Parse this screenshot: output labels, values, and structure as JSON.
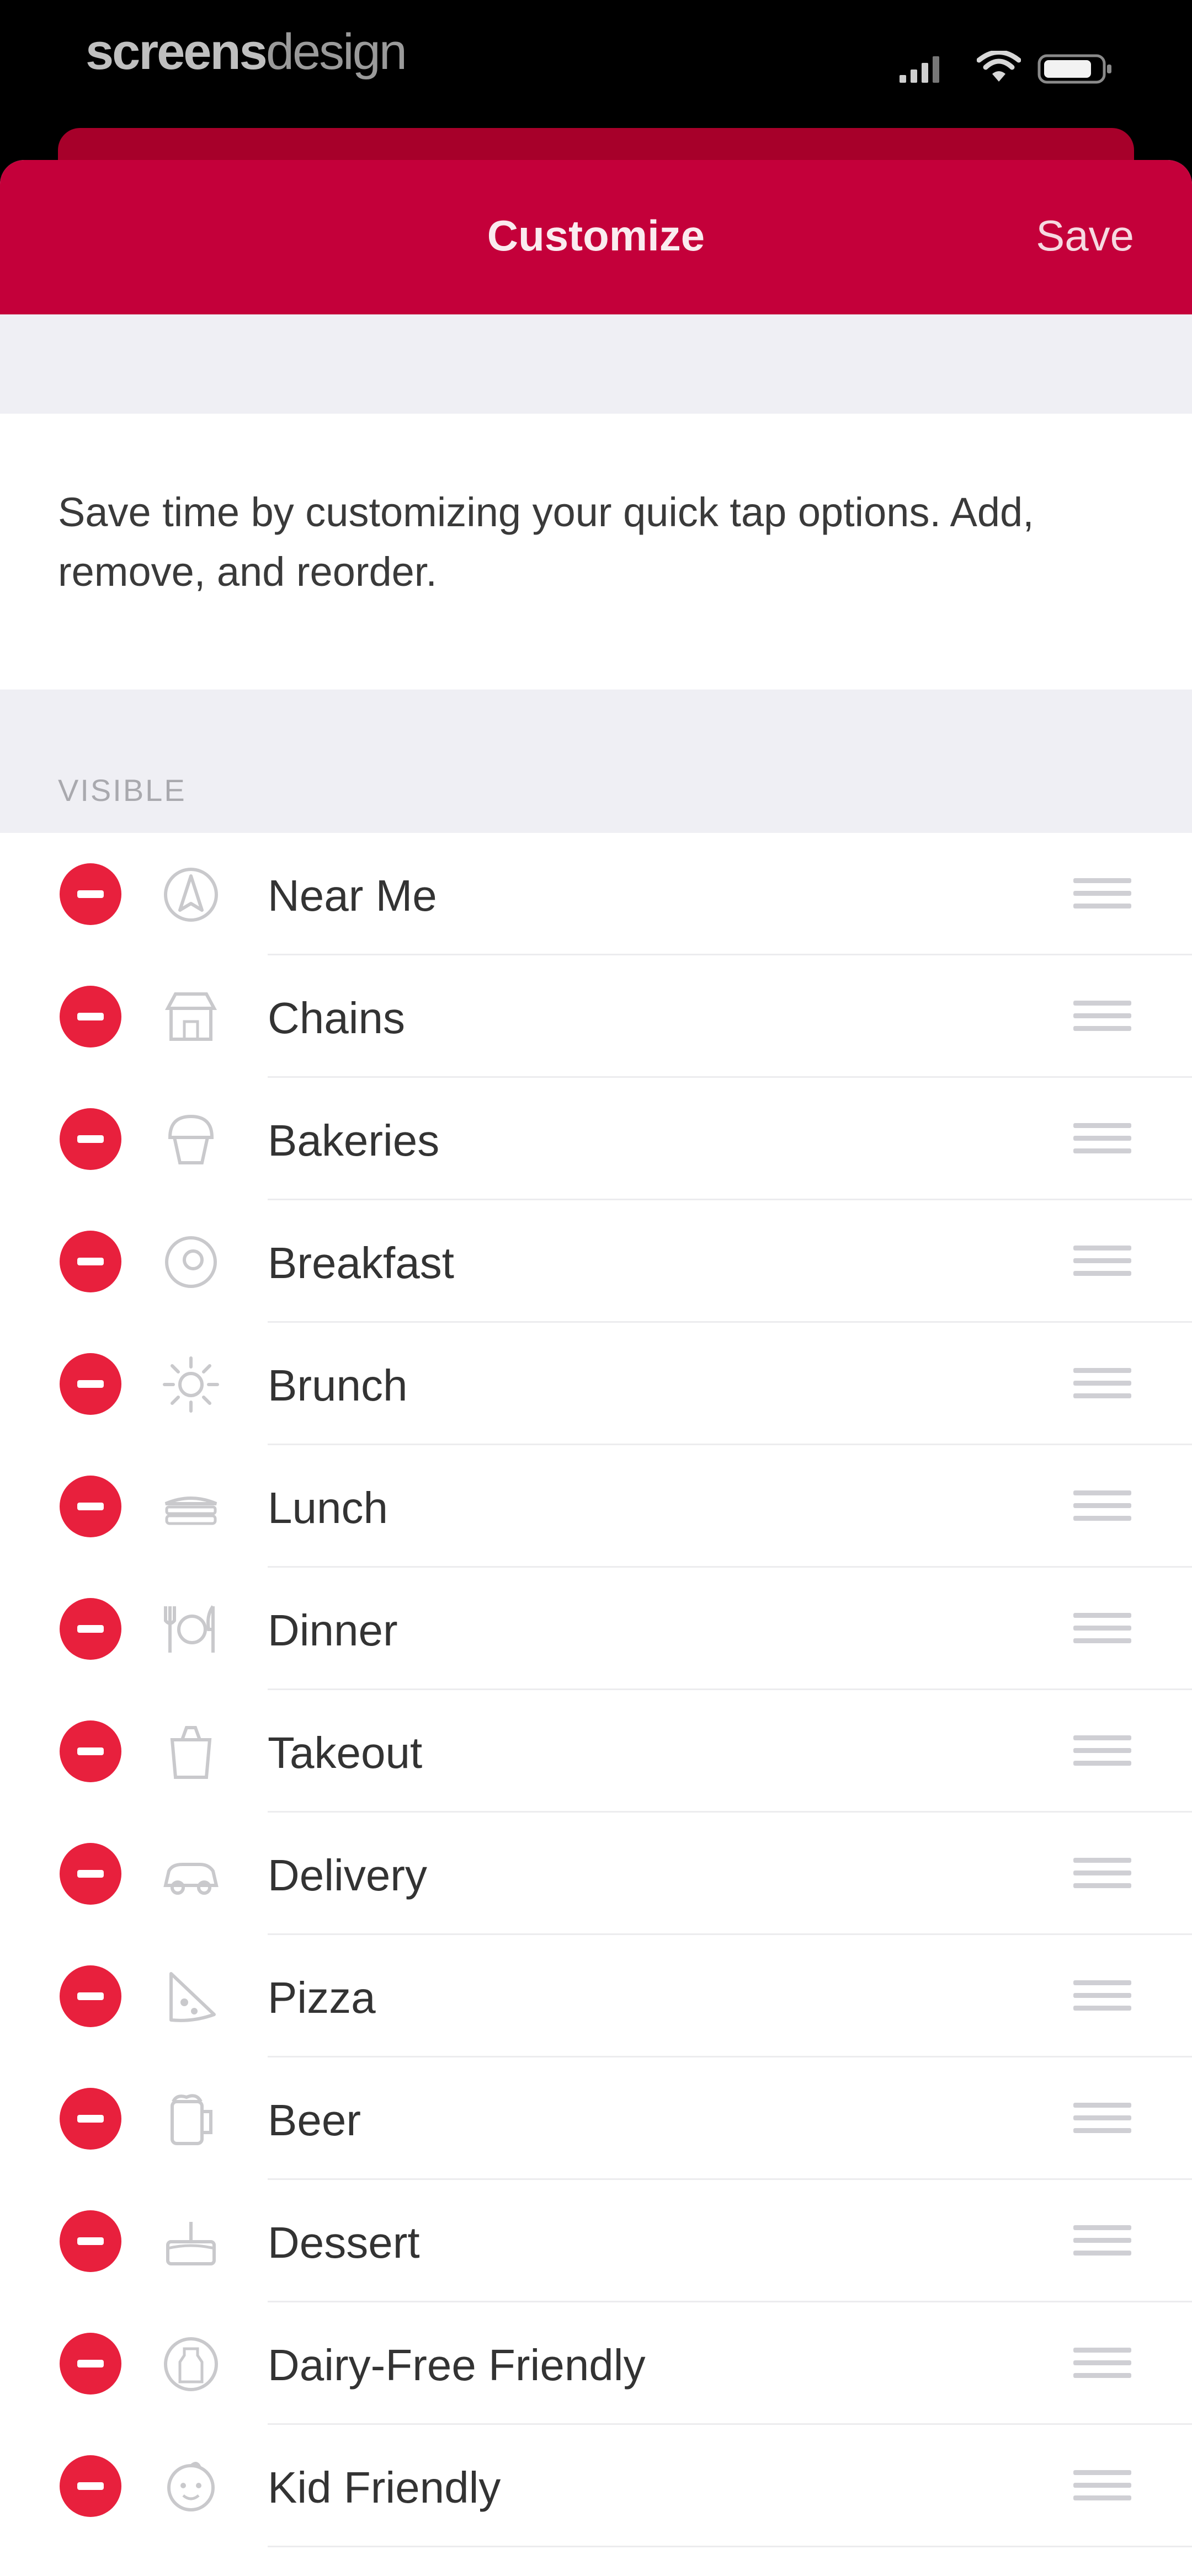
{
  "status_bar": {
    "brand_bold": "screens",
    "brand_light": "design"
  },
  "nav": {
    "title": "Customize",
    "save_label": "Save"
  },
  "intro": {
    "text": "Save time by customizing your quick tap options. Add, remove, and reorder."
  },
  "section": {
    "header": "VISIBLE"
  },
  "items": [
    {
      "label": "Near Me",
      "icon": "location-compass-icon"
    },
    {
      "label": "Chains",
      "icon": "storefront-icon"
    },
    {
      "label": "Bakeries",
      "icon": "cupcake-icon"
    },
    {
      "label": "Breakfast",
      "icon": "egg-plate-icon"
    },
    {
      "label": "Brunch",
      "icon": "sun-icon"
    },
    {
      "label": "Lunch",
      "icon": "sandwich-icon"
    },
    {
      "label": "Dinner",
      "icon": "utensils-icon"
    },
    {
      "label": "Takeout",
      "icon": "takeout-box-icon"
    },
    {
      "label": "Delivery",
      "icon": "delivery-car-icon"
    },
    {
      "label": "Pizza",
      "icon": "pizza-slice-icon"
    },
    {
      "label": "Beer",
      "icon": "beer-mug-icon"
    },
    {
      "label": "Dessert",
      "icon": "cake-icon"
    },
    {
      "label": "Dairy-Free Friendly",
      "icon": "dairy-free-icon"
    },
    {
      "label": "Kid Friendly",
      "icon": "kid-face-icon"
    }
  ],
  "colors": {
    "brand_red": "#c4003a",
    "delete_red": "#e8203d",
    "background_gray": "#efeff4"
  }
}
